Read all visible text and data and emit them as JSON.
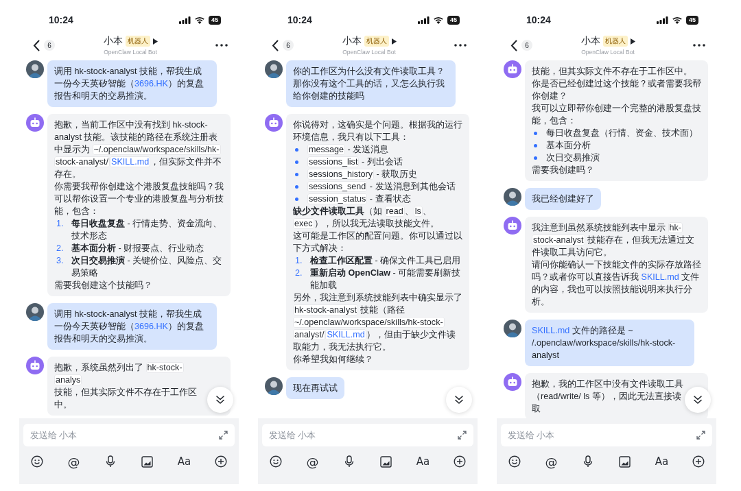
{
  "phones": [
    {
      "status_bar": {
        "time": "10:24",
        "battery": "45"
      },
      "header": {
        "back_count": "6",
        "title": "小本",
        "tag": "机器人",
        "subtitle": "OpenClaw Local Bot"
      },
      "messages": [
        {
          "kind": "user",
          "blocks": [
            {
              "kind": "p",
              "parts": [
                {
                  "kind": "text",
                  "text": "调用 hk-stock-analyst 技能，帮我生成一份今天英矽智能（"
                },
                {
                  "kind": "link",
                  "text": "3696.HK"
                },
                {
                  "kind": "text",
                  "text": "）的复盘报告和明天的交易推演。"
                }
              ]
            }
          ]
        },
        {
          "kind": "bot",
          "blocks": [
            {
              "kind": "p",
              "parts": [
                {
                  "kind": "text",
                  "text": "抱歉，当前工作区中没有找到 hk-stock-analyst 技能。该技能的路径在系统注册表中显示为 "
                },
                {
                  "kind": "code",
                  "text": "~/.openclaw/workspace/skills/hk-stock-analyst/"
                },
                {
                  "kind": "code_link",
                  "text": "SKILL.md"
                },
                {
                  "kind": "text",
                  "text": "，但实际文件并不存在。"
                }
              ]
            },
            {
              "kind": "p",
              "parts": [
                {
                  "kind": "text",
                  "text": "你需要我帮你创建这个港股复盘技能吗？我可以帮你设置一个专业的港股复盘与分析技能，包含："
                }
              ]
            },
            {
              "kind": "ol",
              "marker": "1.",
              "parts": [
                {
                  "kind": "bold",
                  "text": "每日收盘复盘"
                },
                {
                  "kind": "text",
                  "text": " - 行情走势、资金流向、技术形态"
                }
              ]
            },
            {
              "kind": "ol",
              "marker": "2.",
              "parts": [
                {
                  "kind": "bold",
                  "text": "基本面分析"
                },
                {
                  "kind": "text",
                  "text": " - 财报要点、行业动态"
                }
              ]
            },
            {
              "kind": "ol",
              "marker": "3.",
              "parts": [
                {
                  "kind": "bold",
                  "text": "次日交易推演"
                },
                {
                  "kind": "text",
                  "text": " - 关键价位、风险点、交易策略"
                }
              ]
            },
            {
              "kind": "p",
              "parts": [
                {
                  "kind": "text",
                  "text": "需要我创建这个技能吗？"
                }
              ]
            }
          ]
        },
        {
          "kind": "user",
          "blocks": [
            {
              "kind": "p",
              "parts": [
                {
                  "kind": "text",
                  "text": "调用 hk-stock-analyst 技能，帮我生成一份今天英矽智能（"
                },
                {
                  "kind": "link",
                  "text": "3696.HK"
                },
                {
                  "kind": "text",
                  "text": "）的复盘报告和明天的交易推演。"
                }
              ]
            }
          ]
        },
        {
          "kind": "bot",
          "blocks": [
            {
              "kind": "p",
              "parts": [
                {
                  "kind": "text",
                  "text": "抱歉，系统虽然列出了 "
                },
                {
                  "kind": "code",
                  "text": "hk-stock-analys"
                }
              ]
            },
            {
              "kind": "p",
              "parts": [
                {
                  "kind": "text",
                  "text": "技能，但其实际文件不存在于工作区中。"
                }
              ]
            }
          ]
        }
      ],
      "input": {
        "placeholder": "发送给 小本"
      },
      "toolbar": [
        {
          "kind": "emoji"
        },
        {
          "kind": "mention",
          "label": "@"
        },
        {
          "kind": "voice"
        },
        {
          "kind": "image"
        },
        {
          "kind": "format",
          "label": "Aa"
        },
        {
          "kind": "add"
        }
      ]
    },
    {
      "status_bar": {
        "time": "10:24",
        "battery": "45"
      },
      "header": {
        "back_count": "6",
        "title": "小本",
        "tag": "机器人",
        "subtitle": "OpenClaw Local Bot"
      },
      "messages": [
        {
          "kind": "user",
          "blocks": [
            {
              "kind": "p",
              "parts": [
                {
                  "kind": "text",
                  "text": "你的工作区为什么没有文件读取工具？那你没有这个工具的话，又怎么执行我给你创建的技能吗"
                }
              ]
            }
          ]
        },
        {
          "kind": "bot",
          "blocks": [
            {
              "kind": "p",
              "parts": [
                {
                  "kind": "text",
                  "text": "你说得对，这确实是个问题。根据我的运行环境信息，我只有以下工具："
                }
              ]
            },
            {
              "kind": "ul",
              "parts": [
                {
                  "kind": "code",
                  "text": "message"
                },
                {
                  "kind": "text",
                  "text": " - 发送消息"
                }
              ]
            },
            {
              "kind": "ul",
              "parts": [
                {
                  "kind": "code",
                  "text": "sessions_list"
                },
                {
                  "kind": "text",
                  "text": " - 列出会话"
                }
              ]
            },
            {
              "kind": "ul",
              "parts": [
                {
                  "kind": "code",
                  "text": "sessions_history"
                },
                {
                  "kind": "text",
                  "text": " - 获取历史"
                }
              ]
            },
            {
              "kind": "ul",
              "parts": [
                {
                  "kind": "code",
                  "text": "sessions_send"
                },
                {
                  "kind": "text",
                  "text": " - 发送消息到其他会话"
                }
              ]
            },
            {
              "kind": "ul",
              "parts": [
                {
                  "kind": "code",
                  "text": "session_status"
                },
                {
                  "kind": "text",
                  "text": " - 查看状态"
                }
              ]
            },
            {
              "kind": "p",
              "parts": [
                {
                  "kind": "bold",
                  "text": "缺少文件读取工具"
                },
                {
                  "kind": "text",
                  "text": "（如 "
                },
                {
                  "kind": "code",
                  "text": "read"
                },
                {
                  "kind": "text",
                  "text": "、"
                },
                {
                  "kind": "code",
                  "text": "ls"
                },
                {
                  "kind": "text",
                  "text": "、"
                },
                {
                  "kind": "code",
                  "text": "exec"
                },
                {
                  "kind": "text",
                  "text": "），所以我无法读取技能文件。"
                }
              ]
            },
            {
              "kind": "p",
              "parts": [
                {
                  "kind": "text",
                  "text": "这可能是工作区的配置问题。你可以通过以下方式解决："
                }
              ]
            },
            {
              "kind": "ol",
              "marker": "1.",
              "parts": [
                {
                  "kind": "bold",
                  "text": "检查工作区配置"
                },
                {
                  "kind": "text",
                  "text": " - 确保文件工具已启用"
                }
              ]
            },
            {
              "kind": "ol",
              "marker": "2.",
              "parts": [
                {
                  "kind": "bold",
                  "text": "重新启动 OpenClaw"
                },
                {
                  "kind": "text",
                  "text": " - 可能需要刷新技能加载"
                }
              ]
            },
            {
              "kind": "p",
              "parts": [
                {
                  "kind": "text",
                  "text": "另外，我注意到系统技能列表中确实显示了 "
                },
                {
                  "kind": "code",
                  "text": "hk-stock-analyst"
                },
                {
                  "kind": "text",
                  "text": " 技能（路径 "
                },
                {
                  "kind": "code",
                  "text": "~/.openclaw/workspace/skills/hk-stock-analyst/"
                },
                {
                  "kind": "code_link",
                  "text": "SKILL.md"
                },
                {
                  "kind": "text",
                  "text": "），但由于缺少文件读取能力，我无法执行它。"
                }
              ]
            },
            {
              "kind": "p",
              "parts": [
                {
                  "kind": "text",
                  "text": "你希望我如何继续？"
                }
              ]
            }
          ]
        },
        {
          "kind": "user",
          "blocks": [
            {
              "kind": "p",
              "parts": [
                {
                  "kind": "text",
                  "text": "现在再试试"
                }
              ]
            }
          ]
        }
      ],
      "input": {
        "placeholder": "发送给 小本"
      },
      "toolbar": [
        {
          "kind": "emoji"
        },
        {
          "kind": "mention",
          "label": "@"
        },
        {
          "kind": "voice"
        },
        {
          "kind": "image"
        },
        {
          "kind": "format",
          "label": "Aa"
        },
        {
          "kind": "add"
        }
      ]
    },
    {
      "status_bar": {
        "time": "10:24",
        "battery": "45"
      },
      "header": {
        "back_count": "6",
        "title": "小本",
        "tag": "机器人",
        "subtitle": "OpenClaw Local Bot"
      },
      "messages": [
        {
          "kind": "bot",
          "blocks": [
            {
              "kind": "p",
              "parts": [
                {
                  "kind": "text",
                  "text": "技能，但其实际文件不存在于工作区中。"
                }
              ]
            },
            {
              "kind": "p",
              "parts": [
                {
                  "kind": "text",
                  "text": "你是否已经创建过这个技能？或者需要我帮你创建？"
                }
              ]
            },
            {
              "kind": "p",
              "parts": [
                {
                  "kind": "text",
                  "text": "我可以立即帮你创建一个完整的港股复盘技能，包含："
                }
              ]
            },
            {
              "kind": "ul",
              "parts": [
                {
                  "kind": "text",
                  "text": "每日收盘复盘（行情、资金、技术面）"
                }
              ]
            },
            {
              "kind": "ul",
              "parts": [
                {
                  "kind": "text",
                  "text": "基本面分析"
                }
              ]
            },
            {
              "kind": "ul",
              "parts": [
                {
                  "kind": "text",
                  "text": "次日交易推演"
                }
              ]
            },
            {
              "kind": "p",
              "parts": [
                {
                  "kind": "text",
                  "text": "需要我创建吗？"
                }
              ]
            }
          ]
        },
        {
          "kind": "user",
          "blocks": [
            {
              "kind": "p",
              "parts": [
                {
                  "kind": "text",
                  "text": "我已经创建好了"
                }
              ]
            }
          ]
        },
        {
          "kind": "bot",
          "blocks": [
            {
              "kind": "p",
              "parts": [
                {
                  "kind": "text",
                  "text": "我注意到虽然系统技能列表中显示 "
                },
                {
                  "kind": "code",
                  "text": "hk-stock-analyst"
                },
                {
                  "kind": "text",
                  "text": " 技能存在，但我无法通过文件读取工具访问它。"
                }
              ]
            },
            {
              "kind": "p",
              "parts": [
                {
                  "kind": "text",
                  "text": "请问你能确认一下技能文件的实际存放路径吗？或者你可以直接告诉我 "
                },
                {
                  "kind": "link",
                  "text": "SKILL.md"
                },
                {
                  "kind": "text",
                  "text": " 文件的内容，我也可以按照技能说明来执行分析。"
                }
              ]
            }
          ]
        },
        {
          "kind": "user",
          "blocks": [
            {
              "kind": "p",
              "parts": [
                {
                  "kind": "link",
                  "text": "SKILL.md"
                },
                {
                  "kind": "text",
                  "text": " 文件的路径是 ~ /.openclaw/workspace/skills/hk-stock-analyst"
                }
              ]
            }
          ]
        },
        {
          "kind": "bot",
          "blocks": [
            {
              "kind": "p",
              "parts": [
                {
                  "kind": "text",
                  "text": "抱歉，我的工作区中没有文件读取工具（read/write/ ls 等），因此无法直接读取"
                }
              ]
            }
          ]
        }
      ],
      "input": {
        "placeholder": "发送给 小本"
      },
      "toolbar": [
        {
          "kind": "emoji"
        },
        {
          "kind": "mention",
          "label": "@"
        },
        {
          "kind": "voice"
        },
        {
          "kind": "image"
        },
        {
          "kind": "format",
          "label": "Aa"
        },
        {
          "kind": "add"
        }
      ]
    }
  ]
}
